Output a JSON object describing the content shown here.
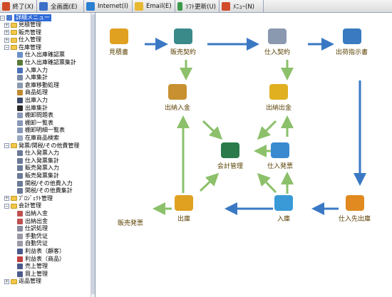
{
  "toolbar": {
    "buttons": [
      {
        "label": "終了(X)",
        "icon": "exit-icon",
        "color": "#d04a2a"
      },
      {
        "label": "全画面(E)",
        "icon": "fullscreen-icon",
        "color": "#3b6fc9"
      },
      {
        "label": "Internet(I)",
        "icon": "internet-icon",
        "color": "#2a7fd0"
      },
      {
        "label": "Email(E)",
        "icon": "email-icon",
        "color": "#e8b830"
      },
      {
        "label": "ｿﾌﾄ更新(U)",
        "icon": "update-icon",
        "color": "#3c9a4b"
      },
      {
        "label": "ﾒﾆｭｰ(N)",
        "icon": "menu-icon",
        "color": "#d24b2a"
      }
    ]
  },
  "sidebar": {
    "title": "詳細メニュー",
    "items": [
      {
        "label": "見積管理",
        "level": 1,
        "type": "folder",
        "exp": "+"
      },
      {
        "label": "販売管理",
        "level": 1,
        "type": "folder",
        "exp": "+"
      },
      {
        "label": "仕入管理",
        "level": 1,
        "type": "folder",
        "exp": "+"
      },
      {
        "label": "在庫管理",
        "level": 1,
        "type": "folder",
        "exp": "−"
      },
      {
        "label": "仕入出庫確認票",
        "level": 2,
        "type": "item",
        "color": "#6b8fc7"
      },
      {
        "label": "仕入出庫確認票集計",
        "level": 2,
        "type": "item",
        "color": "#5a7a3a"
      },
      {
        "label": "入庫入力",
        "level": 2,
        "type": "item",
        "color": "#4a70b8"
      },
      {
        "label": "入庫集計",
        "level": 2,
        "type": "item",
        "color": "#7a8aa8"
      },
      {
        "label": "倉庫移動処理",
        "level": 2,
        "type": "item",
        "color": "#8a9ab0"
      },
      {
        "label": "商品処理",
        "level": 2,
        "type": "item",
        "color": "#c08a30"
      },
      {
        "label": "出庫入力",
        "level": 2,
        "type": "item",
        "color": "#3a4a6a"
      },
      {
        "label": "出庫集計",
        "level": 2,
        "type": "item",
        "color": "#2a2a2a"
      },
      {
        "label": "棚卸問題表",
        "level": 2,
        "type": "item",
        "color": "#8898b8"
      },
      {
        "label": "棚卸一覧表",
        "level": 2,
        "type": "item",
        "color": "#8898b8"
      },
      {
        "label": "棚卸明細一覧表",
        "level": 2,
        "type": "item",
        "color": "#8898b8"
      },
      {
        "label": "在庫商品検索",
        "level": 2,
        "type": "item",
        "color": "#9aa8c0"
      },
      {
        "label": "発票/関税/その他費管理",
        "level": 1,
        "type": "folder",
        "exp": "−"
      },
      {
        "label": "仕入発票入力",
        "level": 2,
        "type": "item",
        "color": "#6a7a98"
      },
      {
        "label": "仕入発票集計",
        "level": 2,
        "type": "item",
        "color": "#6a7a98"
      },
      {
        "label": "販売発票入力",
        "level": 2,
        "type": "item",
        "color": "#6a7a98"
      },
      {
        "label": "販売発票集計",
        "level": 2,
        "type": "item",
        "color": "#6a7a98"
      },
      {
        "label": "関税/その他費入力",
        "level": 2,
        "type": "item",
        "color": "#6a7a98"
      },
      {
        "label": "関税/その他費集計",
        "level": 2,
        "type": "item",
        "color": "#6a7a98"
      },
      {
        "label": "ﾌﾟﾛｼﾞｪｸﾄ管理",
        "level": 1,
        "type": "folder",
        "exp": "+"
      },
      {
        "label": "会計管理",
        "level": 1,
        "type": "folder",
        "exp": "−"
      },
      {
        "label": "出納入金",
        "level": 2,
        "type": "item",
        "color": "#c05050"
      },
      {
        "label": "出納出金",
        "level": 2,
        "type": "item",
        "color": "#c05050"
      },
      {
        "label": "仕訳処理",
        "level": 2,
        "type": "item",
        "color": "#8a8aa0"
      },
      {
        "label": "手動凭证",
        "level": 2,
        "type": "item",
        "color": "#9a9aa8"
      },
      {
        "label": "自動凭证",
        "level": 2,
        "type": "item",
        "color": "#9a9aa8"
      },
      {
        "label": "利益表（顧客）",
        "level": 2,
        "type": "item",
        "color": "#4a5a8a"
      },
      {
        "label": "利益表（商品）",
        "level": 2,
        "type": "item",
        "color": "#c04040"
      },
      {
        "label": "売上管理",
        "level": 2,
        "type": "item",
        "color": "#4a5a8a"
      },
      {
        "label": "買上管理",
        "level": 2,
        "type": "item",
        "color": "#4a5a8a"
      },
      {
        "label": "返品管理",
        "level": 1,
        "type": "folder",
        "exp": "+"
      }
    ]
  },
  "flow": {
    "nodes": [
      {
        "id": "mitsumori",
        "label": "見積書",
        "icon": "coins-hand-icon",
        "color": "#e0a020"
      },
      {
        "id": "hanbai_keiyaku",
        "label": "販売契約",
        "icon": "binder-icon",
        "color": "#3a8a8a"
      },
      {
        "id": "shiire_keiyaku",
        "label": "仕入契約",
        "icon": "document-icon",
        "color": "#8a98b0"
      },
      {
        "id": "shukka",
        "label": "出荷指示書",
        "icon": "notepad-icon",
        "color": "#3a7ac0"
      },
      {
        "id": "suitou_nyukin",
        "label": "出納入金",
        "icon": "coins-stack-icon",
        "color": "#c89030"
      },
      {
        "id": "suitou_shukkin",
        "label": "出納出金",
        "icon": "gold-coins-icon",
        "color": "#e0b020"
      },
      {
        "id": "kaikei",
        "label": "会計管理",
        "icon": "computer-icon",
        "color": "#2a7a4a"
      },
      {
        "id": "shiire_hatsu",
        "label": "仕入発票",
        "icon": "folder-icon",
        "color": "#3a8ad0"
      },
      {
        "id": "hanbai_hatsu",
        "label": "販売発票",
        "icon": "none",
        "color": "#ffffff"
      },
      {
        "id": "shukko",
        "label": "出庫",
        "icon": "box-icon",
        "color": "#e0a020"
      },
      {
        "id": "nyuko",
        "label": "入庫",
        "icon": "tray-icon",
        "color": "#3a9ad8"
      },
      {
        "id": "shiire_saki",
        "label": "仕入先出庫",
        "icon": "boxes-icon",
        "color": "#e08a20"
      }
    ],
    "arrow_colors": {
      "blue": "#3a78c4",
      "green": "#8cc06a"
    }
  }
}
